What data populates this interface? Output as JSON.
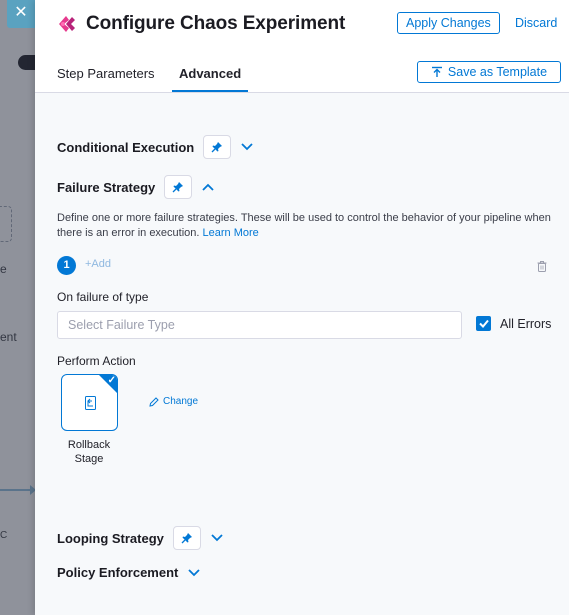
{
  "background": {
    "close_glyph": "✕",
    "fragment_1": "e",
    "fragment_2": "ent",
    "fragment_3": "C"
  },
  "header": {
    "title": "Configure Chaos Experiment",
    "apply_label": "Apply Changes",
    "discard_label": "Discard",
    "logo_icon": "chaos-logo-icon"
  },
  "tabs": [
    {
      "label": "Step Parameters",
      "active": false
    },
    {
      "label": "Advanced",
      "active": true
    }
  ],
  "save_template_label": "Save as Template",
  "sections": {
    "conditional_execution": "Conditional Execution",
    "failure_strategy": "Failure Strategy",
    "looping_strategy": "Looping Strategy",
    "policy_enforcement": "Policy Enforcement"
  },
  "failure": {
    "description": "Define one or more failure strategies. These will be used to control the behavior of your pipeline when there is an error in execution.",
    "learn_more": "Learn More",
    "step_number": "1",
    "add_label": "+Add",
    "on_failure_label": "On failure of type",
    "failure_type_placeholder": "Select Failure Type",
    "all_errors_label": "All Errors",
    "all_errors_checked": true,
    "perform_action_label": "Perform Action",
    "action_label_line1": "Rollback",
    "action_label_line2": "Stage",
    "change_label": "Change"
  },
  "colors": {
    "accent": "#0278d5",
    "logo_pink": "#e63a8e"
  }
}
